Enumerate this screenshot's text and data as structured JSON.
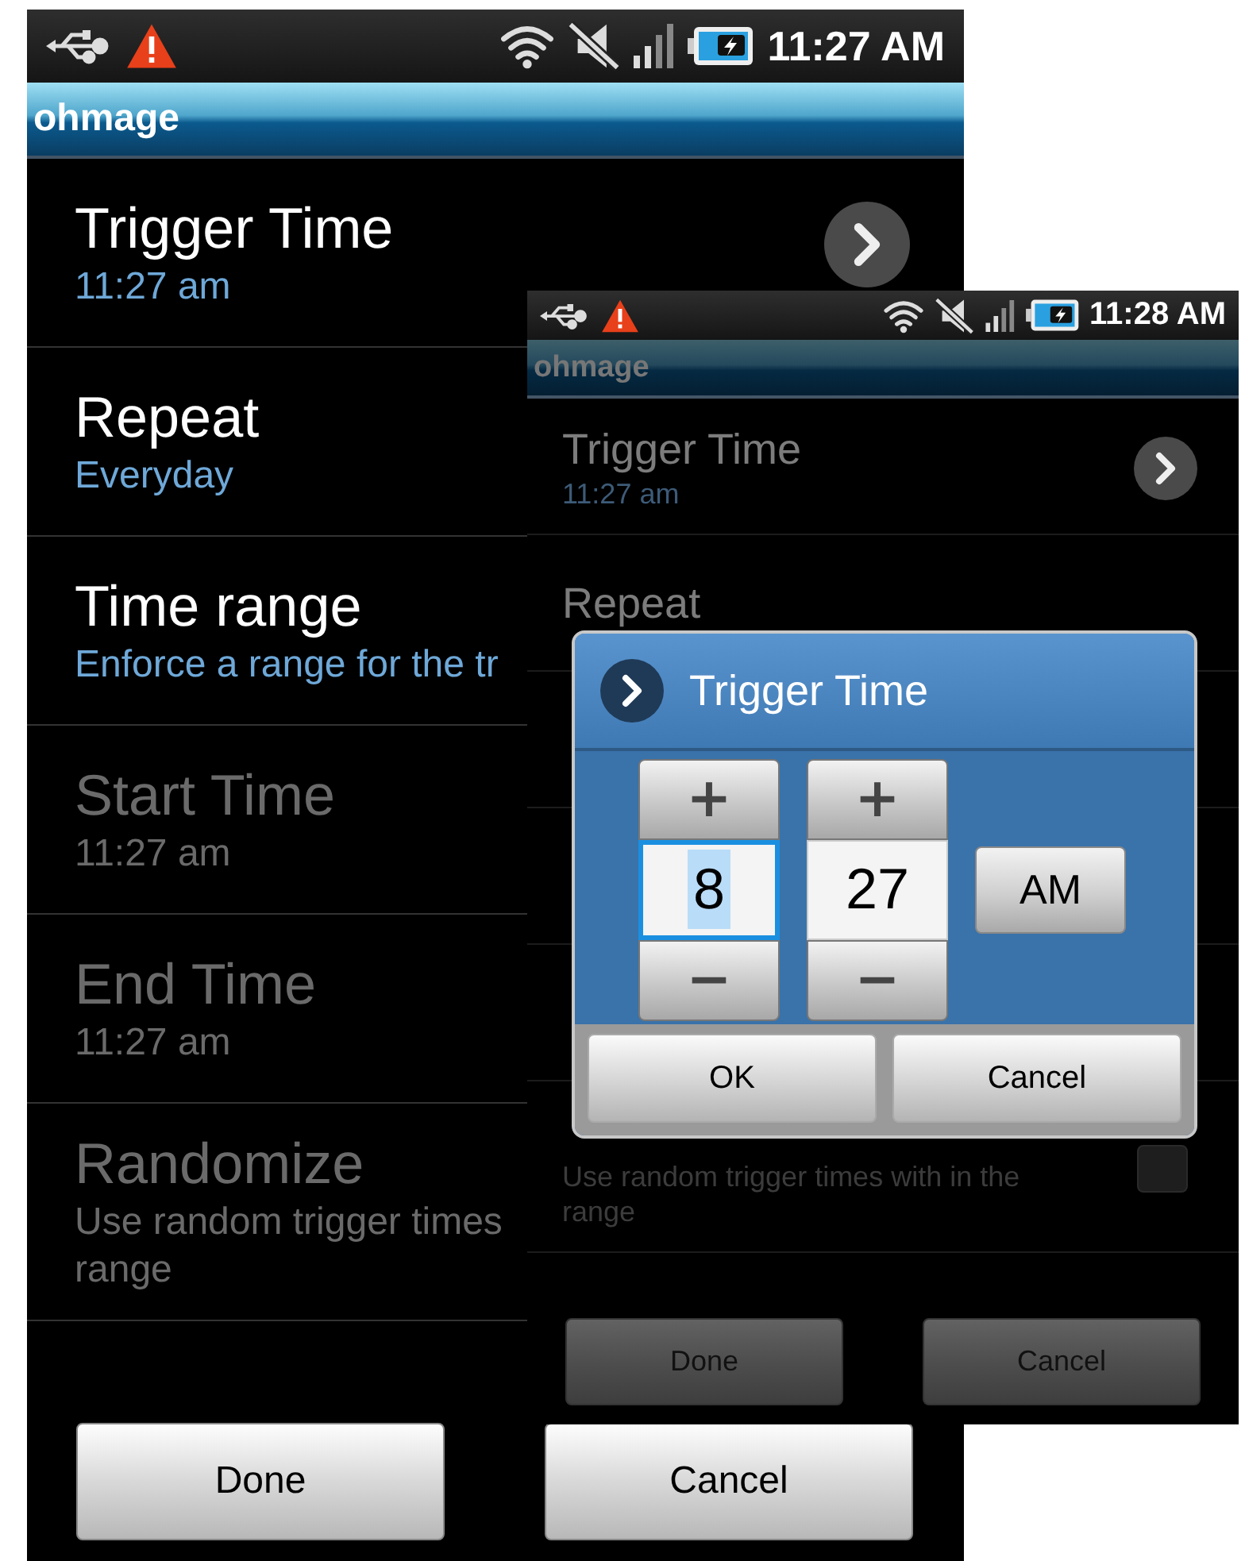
{
  "screens": [
    {
      "status_bar": {
        "time": "11:27 AM"
      },
      "app_title": "ohmage",
      "settings": [
        {
          "kind": "link",
          "title": "Trigger Time",
          "summary": [
            "11:27 am"
          ],
          "disabled": false
        },
        {
          "kind": "text",
          "title": "Repeat",
          "summary": [
            "Everyday"
          ],
          "disabled": false
        },
        {
          "kind": "text",
          "title": "Time range",
          "summary": [
            "Enforce a range for the tr"
          ],
          "disabled": false
        },
        {
          "kind": "text",
          "title": "Start Time",
          "summary": [
            "11:27 am"
          ],
          "disabled": true
        },
        {
          "kind": "text",
          "title": "End Time",
          "summary": [
            "11:27 am"
          ],
          "disabled": true
        },
        {
          "kind": "text",
          "title": "Randomize",
          "summary": [
            "Use random trigger times",
            "range"
          ],
          "disabled": true
        }
      ],
      "buttons": [
        "Done",
        "Cancel"
      ]
    },
    {
      "status_bar": {
        "time": "11:28 AM"
      },
      "app_title": "ohmage",
      "settings": [
        {
          "kind": "link",
          "title": "Trigger Time",
          "summary": [
            "11:27 am"
          ],
          "disabled": false
        },
        {
          "kind": "text",
          "title": "Repeat",
          "disabled": false
        },
        {
          "kind": "text"
        },
        {
          "kind": "text"
        },
        {
          "kind": "text"
        },
        {
          "kind": "checkbox",
          "summary": [
            "Use random trigger times with in the",
            "range"
          ],
          "disabled": true,
          "checked": false
        }
      ],
      "buttons": [
        "Done",
        "Cancel"
      ],
      "dialog": {
        "title": "Trigger Time",
        "pickers": [
          {
            "increment": "+",
            "value": "8",
            "decrement": "−",
            "focused": true
          },
          {
            "increment": "+",
            "value": "27",
            "decrement": "−",
            "focused": false
          }
        ],
        "meridiem": "AM",
        "buttons": [
          "OK",
          "Cancel"
        ]
      }
    }
  ]
}
